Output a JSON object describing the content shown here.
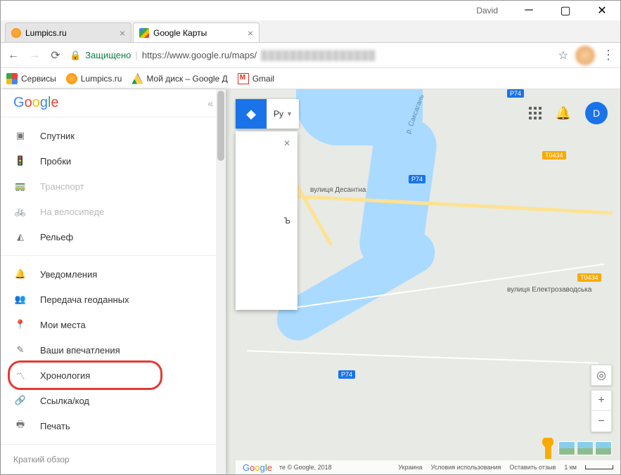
{
  "window": {
    "user": "David"
  },
  "tabs": [
    {
      "title": "Lumpics.ru"
    },
    {
      "title": "Google Карты"
    }
  ],
  "addressBar": {
    "secure_label": "Защищено",
    "url_prefix": "https://www.google.ru/maps/"
  },
  "bookmarks": {
    "apps": "Сервисы",
    "lumpics": "Lumpics.ru",
    "drive": "Мой диск – Google Д",
    "gmail": "Gmail"
  },
  "sidebar": {
    "collapse": "«",
    "section1": [
      {
        "icon": "satellite",
        "label": "Спутник",
        "disabled": false
      },
      {
        "icon": "traffic",
        "label": "Пробки",
        "disabled": false
      },
      {
        "icon": "transit",
        "label": "Транспорт",
        "disabled": true
      },
      {
        "icon": "bike",
        "label": "На велосипеде",
        "disabled": true
      },
      {
        "icon": "terrain",
        "label": "Рельеф",
        "disabled": false
      }
    ],
    "section2": [
      {
        "icon": "bell",
        "label": "Уведомления"
      },
      {
        "icon": "share-location",
        "label": "Передача геоданных"
      },
      {
        "icon": "pin",
        "label": "Мои места"
      },
      {
        "icon": "edit",
        "label": "Ваши впечатления"
      },
      {
        "icon": "timeline",
        "label": "Хронология",
        "highlighted": true
      },
      {
        "icon": "link",
        "label": "Ссылка/код"
      },
      {
        "icon": "print",
        "label": "Печать"
      }
    ],
    "footer": "Краткий обзор"
  },
  "search": {
    "lang": "Ру",
    "dropdown_char": "Ъ",
    "close": "✕"
  },
  "map": {
    "street1": "вулиця Десантна",
    "street2": "вулиця Електрозаводська",
    "river": "р. Саксагань",
    "badges": {
      "p74": "P74",
      "t0434": "T0434"
    }
  },
  "topRight": {
    "avatar_letter": "D"
  },
  "footer": {
    "copyright": "те © Google, 2018",
    "country": "Украина",
    "terms": "Условия использования",
    "feedback": "Оставить отзыв",
    "scale": "1 км"
  }
}
